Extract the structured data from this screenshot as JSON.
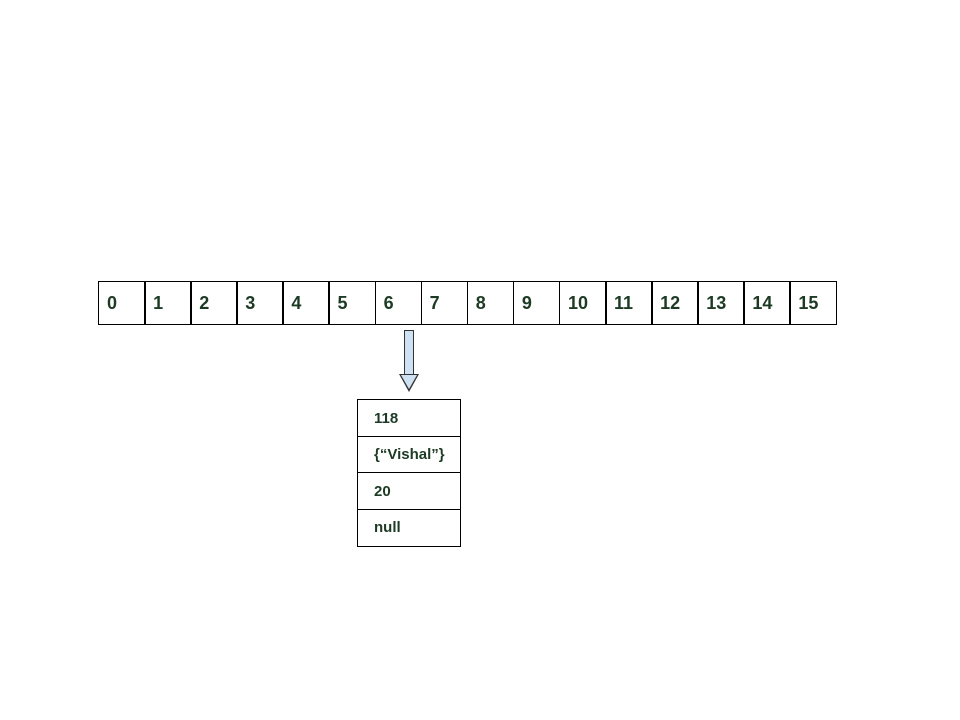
{
  "array": {
    "indices": [
      "0",
      "1",
      "2",
      "3",
      "4",
      "5",
      "6",
      "7",
      "8",
      "9",
      "10",
      "11",
      "12",
      "13",
      "14",
      "15"
    ],
    "pointer_from_index": 6
  },
  "node": {
    "fields": [
      "118",
      "{“Vishal”}",
      "20",
      "null"
    ]
  }
}
